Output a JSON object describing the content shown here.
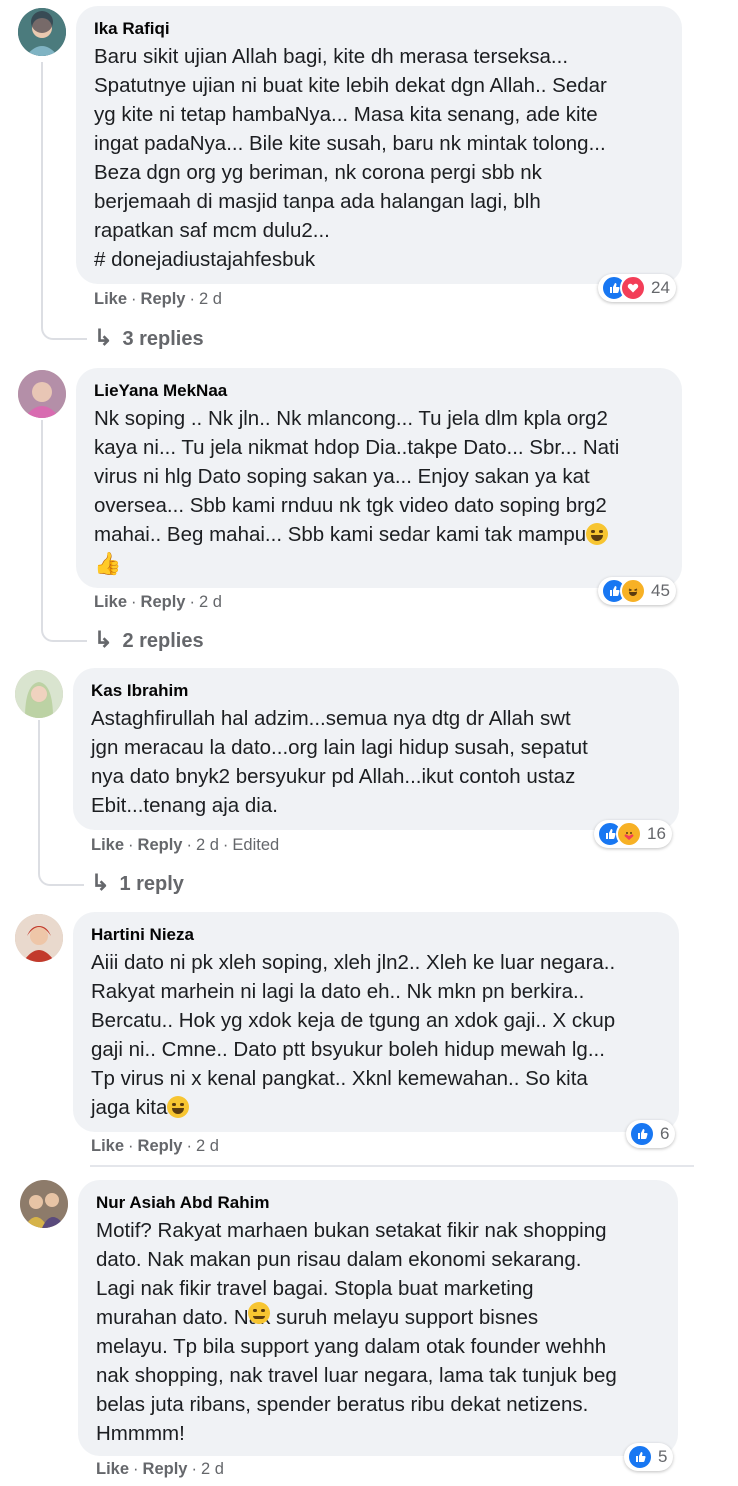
{
  "comments": [
    {
      "author": "Ika Rafiqi",
      "text": "Baru sikit ujian Allah bagi, kite dh merasa terseksa...\nSpatutnye ujian ni buat kite lebih dekat dgn Allah.. Sedar\nyg kite ni tetap hambaNya... Masa kita senang, ade kite\ningat padaNya... Bile kite susah, baru nk mintak tolong...\nBeza dgn org yg beriman, nk corona pergi sbb nk\nberjemaah di masjid tanpa ada halangan lagi, blh\nrapatkan saf mcm dulu2...\n# donejadiustajahfesbuk",
      "like": "Like",
      "reply": "Reply",
      "time": "2 d",
      "reaction_count": "24",
      "replies": "3 replies"
    },
    {
      "author": "LieYana MekNaa",
      "text": "Nk soping .. Nk jln.. Nk mlancong... Tu jela dlm kpla org2\nkaya ni... Tu jela nikmat hdop Dia..takpe Dato... Sbr... Nati\nvirus ni hlg Dato soping sakan ya... Enjoy sakan ya kat\noversea... Sbb kami rnduu nk tgk video dato soping brg2\nmahai.. Beg mahai... Sbb kami sedar kami tak mampu",
      "like": "Like",
      "reply": "Reply",
      "time": "2 d",
      "reaction_count": "45",
      "replies": "2 replies"
    },
    {
      "author": "Kas Ibrahim",
      "text": "Astaghfirullah hal adzim...semua nya dtg dr Allah swt\njgn meracau la dato...org lain lagi hidup susah, sepatut\nnya dato bnyk2 bersyukur pd Allah...ikut contoh ustaz\nEbit...tenang aja dia.",
      "like": "Like",
      "reply": "Reply",
      "time": "2 d",
      "edited": "Edited",
      "reaction_count": "16",
      "replies": "1 reply"
    },
    {
      "author": "Hartini Nieza",
      "text": "Aiii dato ni pk xleh soping, xleh jln2.. Xleh ke luar negara..\nRakyat marhein ni lagi la dato eh.. Nk mkn pn berkira..\nBercatu.. Hok yg xdok keja de tgung an xdok gaji.. X ckup\ngaji ni.. Cmne.. Dato ptt bsyukur boleh hidup mewah lg...\nTp virus ni x kenal pangkat.. Xknl kemewahan.. So kita\njaga kita",
      "like": "Like",
      "reply": "Reply",
      "time": "2 d",
      "reaction_count": "6"
    },
    {
      "author": "Nur Asiah Abd Rahim",
      "text": "Motif? Rakyat marhaen bukan setakat fikir nak shopping\ndato. Nak makan pun risau dalam ekonomi sekarang.\nLagi nak fikir travel bagai. Stopla buat marketing\nmurahan dato.   Nak suruh melayu support bisnes\nmelayu. Tp bila support yang dalam otak founder wehhh\nnak shopping, nak travel luar negara, lama tak tunjuk beg\nbelas juta ribans, spender beratus ribu dekat netizens.\nHmmmm!",
      "like": "Like",
      "reply": "Reply",
      "time": "2 d",
      "reaction_count": "5"
    }
  ]
}
